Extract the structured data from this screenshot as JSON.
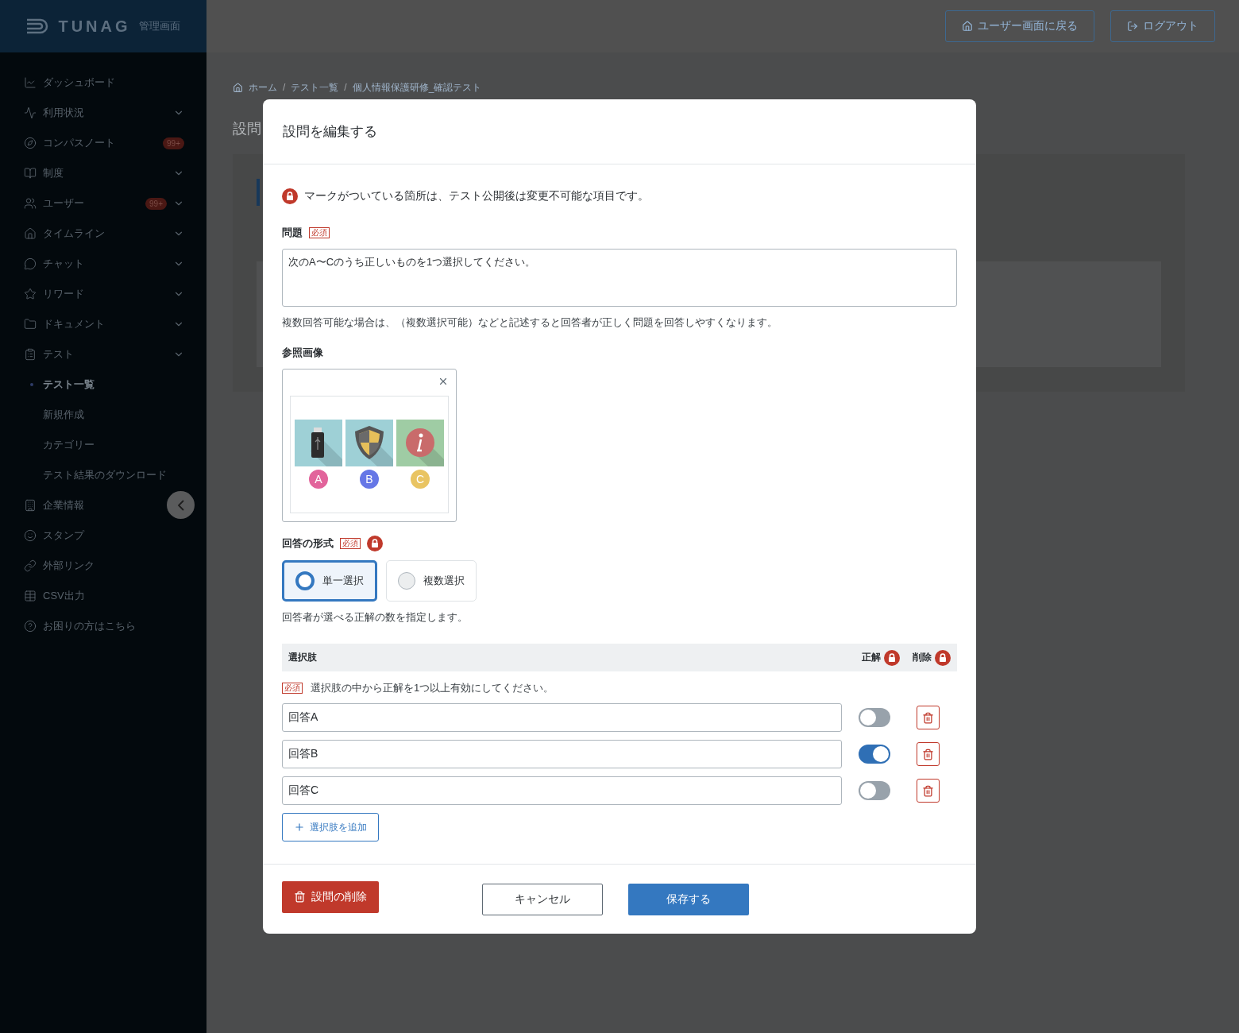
{
  "brand": {
    "logo": "TUNAG",
    "subtitle": "管理画面"
  },
  "header": {
    "buttons": [
      {
        "label": "ユーザー画面に戻る",
        "kind": "home"
      },
      {
        "label": "ログアウト",
        "kind": "logout"
      }
    ]
  },
  "sidebar": {
    "items": [
      {
        "label": "ダッシュボード",
        "has_submenu": false
      },
      {
        "label": "利用状況",
        "has_submenu": true
      },
      {
        "label": "コンパスノート",
        "has_submenu": false,
        "badge": "99+"
      },
      {
        "label": "制度",
        "has_submenu": true
      },
      {
        "label": "ユーザー",
        "has_submenu": true,
        "badge": "99+"
      },
      {
        "label": "タイムライン",
        "has_submenu": true
      },
      {
        "label": "チャット",
        "has_submenu": true
      },
      {
        "label": "リワード",
        "has_submenu": true
      },
      {
        "label": "ドキュメント",
        "has_submenu": true
      },
      {
        "label": "テスト",
        "has_submenu": true,
        "children": [
          {
            "label": "テスト一覧",
            "selected": true
          },
          {
            "label": "新規作成",
            "selected": false
          },
          {
            "label": "カテゴリー",
            "selected": false
          },
          {
            "label": "テスト結果のダウンロード",
            "selected": false
          }
        ]
      },
      {
        "label": "企業情報",
        "has_submenu": false
      },
      {
        "label": "スタンプ",
        "has_submenu": false
      },
      {
        "label": "外部リンク",
        "has_submenu": false
      },
      {
        "label": "CSV出力",
        "has_submenu": false
      },
      {
        "label": "お困りの方はこちら",
        "has_submenu": false
      }
    ]
  },
  "breadcrumb": {
    "separator": "/",
    "items": [
      "ホーム",
      "テスト一覧",
      "個人情報保護研修_確認テスト"
    ]
  },
  "page_title": "設問",
  "modal": {
    "title": "設問を編集する",
    "lock_notice": "マークがついている箇所は、テスト公開後は変更不可能な項目です。",
    "question": {
      "label": "問題",
      "badge": "必須",
      "value": "次のA〜Cのうち正しいものを1つ選択してください。",
      "help": "複数回答可能な場合は、（複数選択可能）などと記述すると回答者が正しく問題を回答しやすくなります。"
    },
    "reference_image": {
      "label": "参照画像",
      "marks": [
        {
          "text": "A",
          "color": "#e2649b"
        },
        {
          "text": "B",
          "color": "#6677e6"
        },
        {
          "text": "C",
          "color": "#e9c462"
        }
      ]
    },
    "answer_format": {
      "label": "回答の形式",
      "badge": "必須",
      "locked": true,
      "options": [
        {
          "label": "単一選択",
          "selected": true
        },
        {
          "label": "複数選択",
          "selected": false
        }
      ],
      "help": "回答者が選べる正解の数を指定します。"
    },
    "choices": {
      "columns": [
        {
          "label": "選択肢",
          "locked": false
        },
        {
          "label": "正解",
          "locked": true
        },
        {
          "label": "削除",
          "locked": true
        }
      ],
      "badge": "必須",
      "note": "選択肢の中から正解を1つ以上有効にしてください。",
      "rows": [
        {
          "value": "回答A",
          "correct": false
        },
        {
          "value": "回答B",
          "correct": true
        },
        {
          "value": "回答C",
          "correct": false
        }
      ],
      "add_button": "選択肢を追加"
    },
    "footer": {
      "delete_button": "設問の削除",
      "cancel_button": "キャンセル",
      "save_button": "保存する"
    }
  }
}
